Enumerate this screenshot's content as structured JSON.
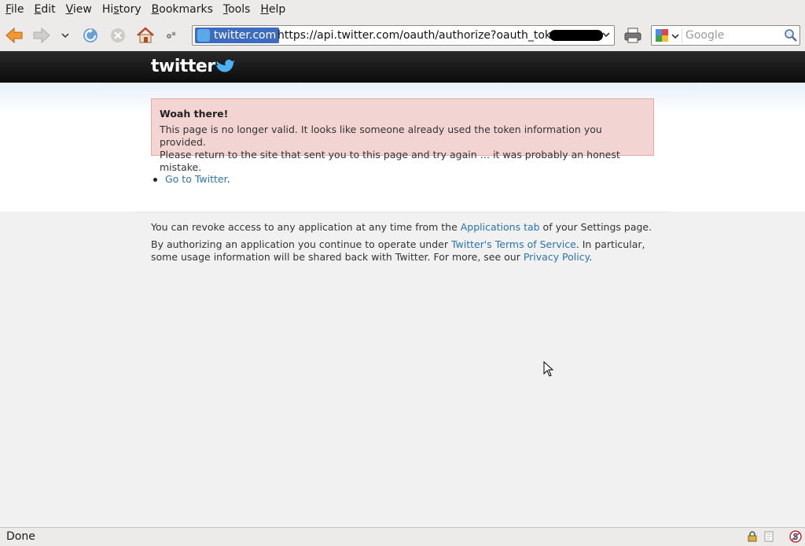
{
  "menubar": {
    "items": [
      {
        "pre": "",
        "u": "F",
        "post": "ile"
      },
      {
        "pre": "",
        "u": "E",
        "post": "dit"
      },
      {
        "pre": "",
        "u": "V",
        "post": "iew"
      },
      {
        "pre": "Hi",
        "u": "s",
        "post": "tory"
      },
      {
        "pre": "",
        "u": "B",
        "post": "ookmarks"
      },
      {
        "pre": "",
        "u": "T",
        "post": "ools"
      },
      {
        "pre": "",
        "u": "H",
        "post": "elp"
      }
    ]
  },
  "urlbar": {
    "identity_label": "twitter.com",
    "url": "https://api.twitter.com/oauth/authorize?oauth_token="
  },
  "search": {
    "placeholder": "Google"
  },
  "page": {
    "logo_text": "twitter",
    "error_title": "Woah there!",
    "error_line1": "This page is no longer valid. It looks like someone already used the token information you provided.",
    "error_line2": "Please return to the site that sent you to this page and try again … it was probably an honest mistake.",
    "go_link": "Go to Twitter",
    "go_suffix": ".",
    "revoke_pre": "You can revoke access to any application at any time from the ",
    "revoke_link": "Applications tab",
    "revoke_post": " of your Settings page.",
    "auth_pre": "By authorizing an application you continue to operate under ",
    "auth_link": "Twitter's Terms of Service",
    "auth_mid": ". In particular, some usage information will be shared back with Twitter. For more, see our ",
    "privacy_link": "Privacy Policy",
    "auth_end": "."
  },
  "status": {
    "text": "Done"
  },
  "colors": {
    "link": "#2a74b6",
    "error_bg": "#f2d4d2",
    "error_border": "#e6aaa6",
    "header": "#111111"
  }
}
